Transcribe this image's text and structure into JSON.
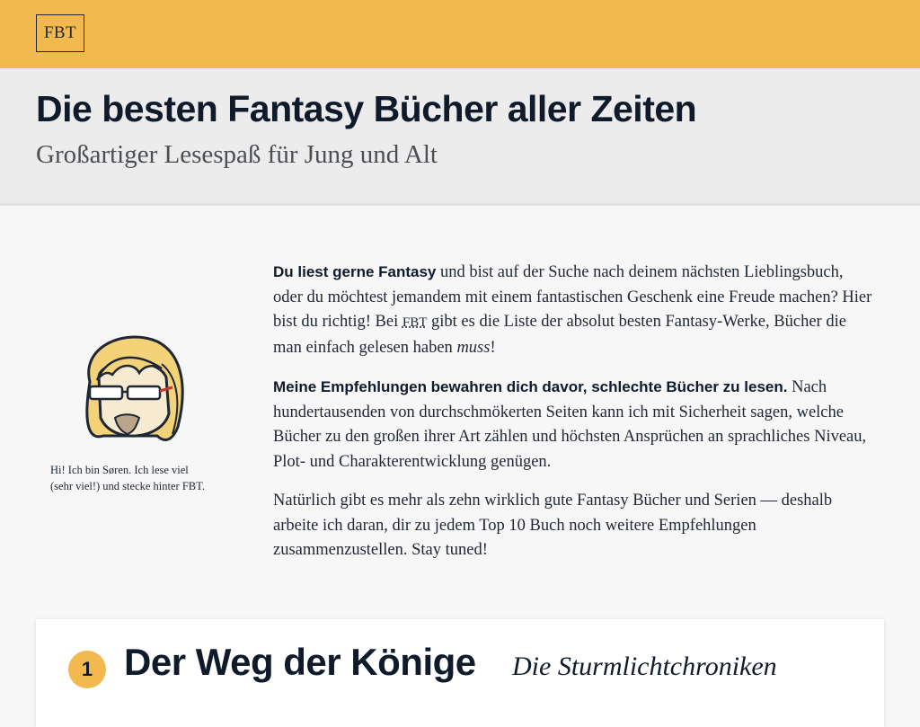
{
  "header": {
    "logo_text": "FBT"
  },
  "hero": {
    "title": "Die besten Fantasy Bücher aller Zeiten",
    "subtitle": "Großartiger Lesespaß für Jung und Alt"
  },
  "author": {
    "caption_line1": "Hi! Ich bin Søren. Ich lese viel",
    "caption_line2": "(sehr viel!) und stecke hinter FBT."
  },
  "intro": {
    "p1_lead": "Du liest gerne Fantasy",
    "p1_text_a": " und bist auf der Suche nach deinem nächsten Lieblingsbuch, oder du möchtest jemandem mit einem fantastischen Geschenk eine Freude machen? Hier bist du richtig! Bei ",
    "p1_abbr": "FBT",
    "p1_text_b": " gibt es die Liste der absolut besten Fantasy-Werke, Bücher die man einfach gelesen haben ",
    "p1_em": "muss",
    "p1_end": "!",
    "p2_lead": "Meine Empfehlungen bewahren dich davor, schlechte Bücher zu lesen.",
    "p2_text": " Nach hundertausenden von durchschmökerten Seiten kann ich mit Sicherheit sagen, welche Bücher zu den großen ihrer Art zählen und höchsten Ansprüchen an sprachliches Niveau, Plot- und Charakterentwicklung genügen.",
    "p3_text": "Natürlich gibt es mehr als zehn wirklich gute Fantasy Bücher und Serien — deshalb arbeite ich daran, dir zu jedem Top 10 Buch noch weitere Empfehlungen zusammenzustellen. Stay tuned!"
  },
  "books": [
    {
      "rank": "1",
      "title": "Der Weg der Könige",
      "series": "Die Sturmlichtchroniken"
    }
  ],
  "colors": {
    "accent": "#f2b94f",
    "text": "#0f1b2b",
    "hero_bg": "#ececec"
  }
}
